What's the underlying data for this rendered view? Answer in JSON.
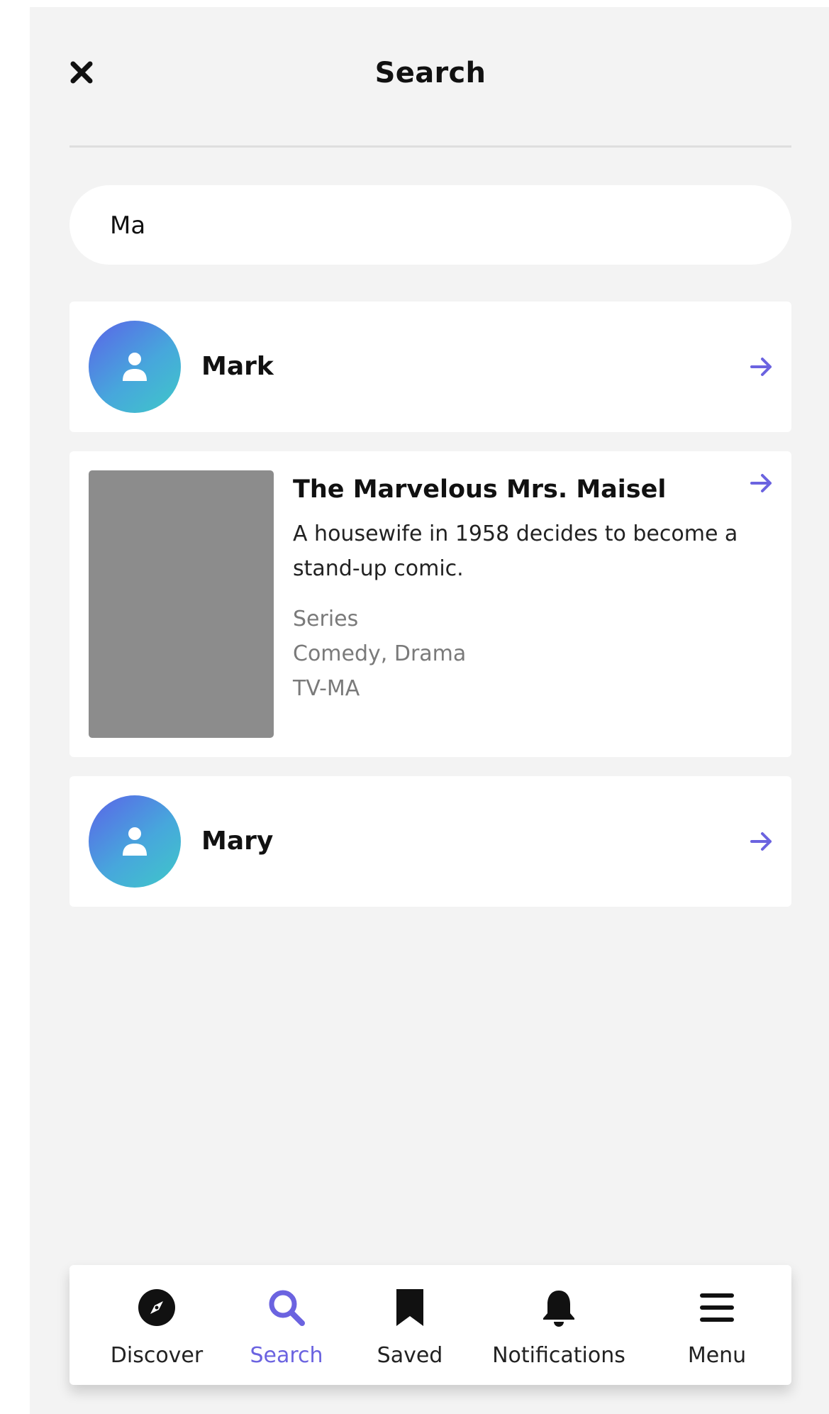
{
  "header": {
    "title": "Search",
    "close_icon": "close-icon"
  },
  "search": {
    "value": "Ma",
    "placeholder": ""
  },
  "results": [
    {
      "type": "person",
      "name": "Mark",
      "avatar_icon": "user-icon"
    },
    {
      "type": "show",
      "title": "The Marvelous Mrs. Maisel",
      "description": "A housewife in 1958 decides to become a stand-up comic.",
      "category": "Series",
      "genres": "Comedy, Drama",
      "rating": "TV-MA"
    },
    {
      "type": "person",
      "name": "Mary",
      "avatar_icon": "user-icon"
    }
  ],
  "tabbar": {
    "active": "Search",
    "tabs": [
      {
        "label": "Discover",
        "icon": "compass-icon"
      },
      {
        "label": "Search",
        "icon": "search-icon"
      },
      {
        "label": "Saved",
        "icon": "bookmark-icon"
      },
      {
        "label": "Notifications",
        "icon": "bell-icon"
      },
      {
        "label": "Menu",
        "icon": "menu-icon"
      }
    ]
  },
  "colors": {
    "accent": "#6b63e0",
    "background": "#f3f3f3",
    "card": "#ffffff",
    "poster_placeholder": "#8c8c8c"
  }
}
